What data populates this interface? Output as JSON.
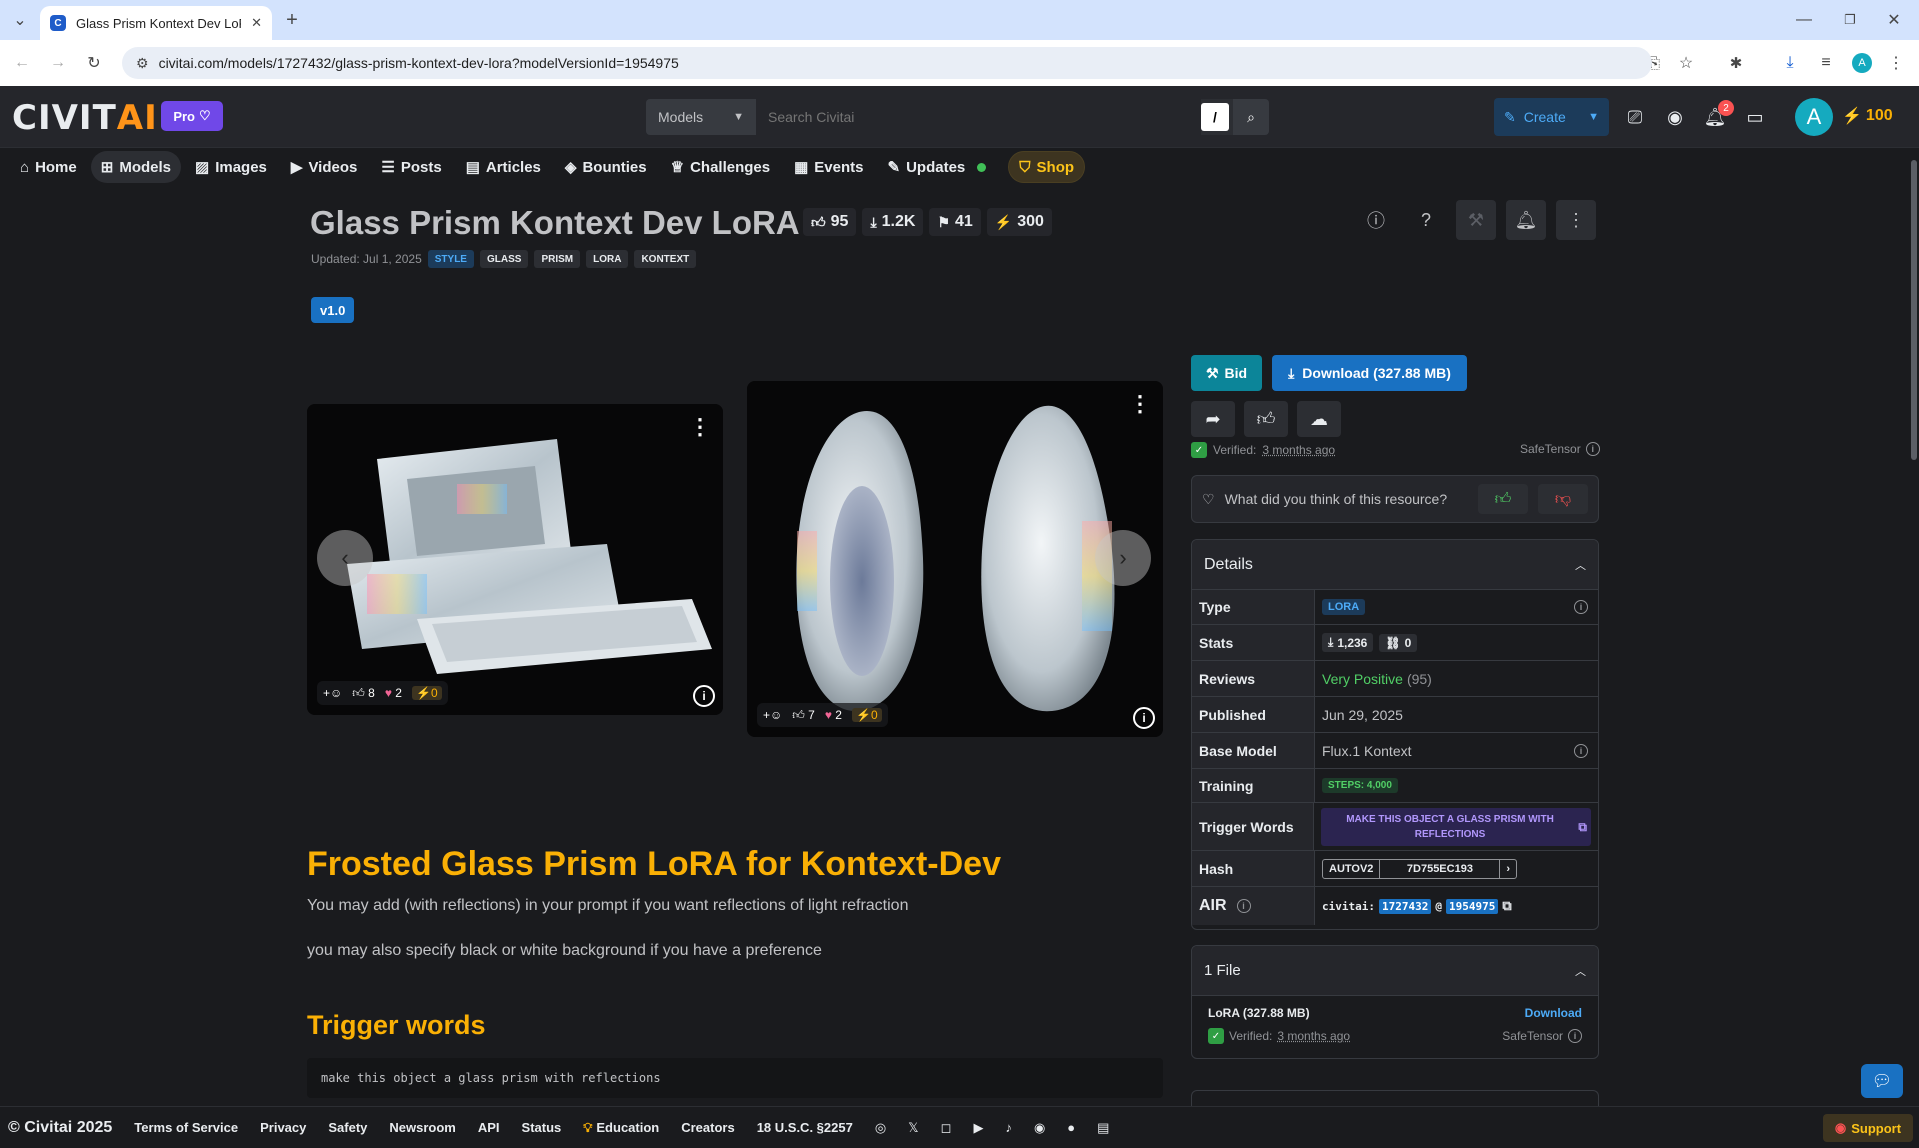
{
  "browser": {
    "tab_title": "Glass Prism Kontext Dev LoRA",
    "url": "civitai.com/models/1727432/glass-prism-kontext-dev-lora?modelVersionId=1954975"
  },
  "header": {
    "logo_a": "CIVIT",
    "logo_b": "AI",
    "pro_label": "Pro",
    "search_scope": "Models",
    "search_placeholder": "Search Civitai",
    "search_shortcut": "/",
    "create_label": "Create",
    "notification_count": "2",
    "avatar_initial": "A",
    "buzz_amount": "100"
  },
  "nav": [
    {
      "label": "Home",
      "icon": "home-icon"
    },
    {
      "label": "Models",
      "icon": "grid-icon"
    },
    {
      "label": "Images",
      "icon": "image-icon"
    },
    {
      "label": "Videos",
      "icon": "video-icon"
    },
    {
      "label": "Posts",
      "icon": "posts-icon"
    },
    {
      "label": "Articles",
      "icon": "article-icon"
    },
    {
      "label": "Bounties",
      "icon": "bounty-icon"
    },
    {
      "label": "Challenges",
      "icon": "trophy-icon"
    },
    {
      "label": "Events",
      "icon": "calendar-icon"
    },
    {
      "label": "Updates",
      "icon": "updates-icon"
    },
    {
      "label": "Shop",
      "icon": "shop-icon"
    }
  ],
  "model": {
    "title": "Glass Prism Kontext Dev LoRA",
    "likes": "95",
    "downloads": "1.2K",
    "bookmarks": "41",
    "buzz": "300",
    "updated": "Updated: Jul 1, 2025",
    "tags": [
      "STYLE",
      "GLASS",
      "PRISM",
      "LORA",
      "KONTEXT"
    ],
    "version": "v1.0"
  },
  "gallery": [
    {
      "likes": "8",
      "hearts": "2",
      "buzz": "0"
    },
    {
      "likes": "7",
      "hearts": "2",
      "buzz": "0"
    }
  ],
  "description": {
    "heading": "Frosted Glass Prism LoRA for Kontext-Dev",
    "p1": "You may add (with reflections) in your prompt if you want reflections of light refraction",
    "p2": "you may also specify black or white background if you have a preference",
    "trigger_heading": "Trigger words",
    "trigger_code": "make this object a glass prism with reflections"
  },
  "sidebar": {
    "bid_label": "Bid",
    "download_label": "Download (327.88 MB)",
    "verified_label": "Verified:",
    "verified_time": "3 months ago",
    "safetensor": "SafeTensor",
    "feedback_prompt": "What did you think of this resource?",
    "details_title": "Details",
    "type_label": "Type",
    "type_value": "LORA",
    "stats_label": "Stats",
    "stats_downloads": "1,236",
    "stats_links": "0",
    "reviews_label": "Reviews",
    "reviews_value": "Very Positive",
    "reviews_count": "(95)",
    "published_label": "Published",
    "published_value": "Jun 29, 2025",
    "base_model_label": "Base Model",
    "base_model_value": "Flux.1 Kontext",
    "training_label": "Training",
    "training_value": "STEPS: 4,000",
    "trigger_label": "Trigger Words",
    "trigger_value": "MAKE THIS OBJECT A GLASS PRISM WITH REFLECTIONS",
    "hash_label": "Hash",
    "hash_algo": "AUTOV2",
    "hash_value": "7D755EC193",
    "air_label": "AIR",
    "air_prefix": "civitai:",
    "air_model": "1727432",
    "air_at": "@",
    "air_version": "1954975",
    "files_title": "1 File",
    "file_name": "LoRA (327.88 MB)",
    "file_download": "Download"
  },
  "footer": {
    "copyright": "© Civitai 2025",
    "links": [
      "Terms of Service",
      "Privacy",
      "Safety",
      "Newsroom",
      "API",
      "Status",
      "Education",
      "Creators",
      "18 U.S.C. §2257"
    ],
    "support": "Support"
  }
}
